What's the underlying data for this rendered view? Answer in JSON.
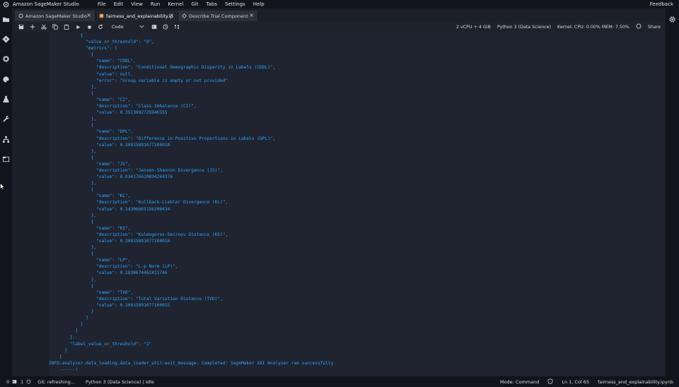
{
  "app": {
    "title": "Amazon SageMaker Studio",
    "feedback": "Feedback"
  },
  "menu": [
    "File",
    "Edit",
    "View",
    "Run",
    "Kernel",
    "Git",
    "Tabs",
    "Settings",
    "Help"
  ],
  "tabs": [
    {
      "label": "Amazon SageMaker Studio",
      "icon": "sagemaker-icon",
      "active": false
    },
    {
      "label": "fairness_and_explainability.ip",
      "icon": "notebook-icon",
      "active": true
    },
    {
      "label": "Describe Trial Component",
      "icon": "experiment-icon",
      "active": false
    }
  ],
  "toolbar": {
    "cell_type": "Code",
    "instance": "2 vCPU + 4 GiB",
    "kernel_name": "Python 3 (Data Science)",
    "kernel_usage": "Kernel: CPU: 0.00% MEM: 7.50%",
    "share": "Share"
  },
  "output": {
    "lines": [
      "            {",
      "              \"value_or_threshold\": \"0\",",
      "              \"metrics\": [",
      "                {",
      "                  \"name\": \"CDDL\",",
      "                  \"description\": \"Conditional Demographic Disparity in Labels (CDDL)\",",
      "                  \"value\": null,",
      "                  \"error\": \"Group variable is empty or not provided\"",
      "                },",
      "                {",
      "                  \"name\": \"CI\",",
      "                  \"description\": \"Class Imbalance (CI)\",",
      "                  \"value\": 0.3513692725946555",
      "                },",
      "                {",
      "                  \"name\": \"DPL\",",
      "                  \"description\": \"Difference in Positive Proportions in Labels (DPL)\",",
      "                  \"value\": 0.20015891077100018",
      "                },",
      "                {",
      "                  \"name\": \"JS\",",
      "                  \"description\": \"Jensen-Shannon Divergence (JS)\",",
      "                  \"value\": 0.034176620894264376",
      "                },",
      "                {",
      "                  \"name\": \"KL\",",
      "                  \"description\": \"Kullback-Liebler Divergence (KL)\",",
      "                  \"value\": 0.14306865156306434",
      "                },",
      "                {",
      "                  \"name\": \"KS\",",
      "                  \"description\": \"Kolmogorov-Smirnov Distance (KS)\",",
      "                  \"value\": 0.20015891077100018",
      "                },",
      "                {",
      "                  \"name\": \"LP\",",
      "                  \"description\": \"L-p Norm (LP)\",",
      "                  \"value\": 0.2830674462421746",
      "                },",
      "                {",
      "                  \"name\": \"TVD\",",
      "                  \"description\": \"Total Variation Distance (TVD)\",",
      "                  \"value\": 0.20015891077100015",
      "                }",
      "              ]",
      "            }",
      "          ]",
      "        },",
      "        \"label_value_or_threshold\": \"1\"",
      "      }",
      "    }",
      "INFO:analyzer.data_loading.data_loader_util:exit_message: Completed: SageMaker XAI Analyzer ran successfully",
      "    ------!"
    ]
  },
  "status": {
    "zero": "0",
    "one": "1",
    "git": "Git: refreshing...",
    "kernel": "Python 3 (Data Science) | Idle",
    "mode": "Mode: Command",
    "position": "Ln 1, Col 65",
    "file": "fairness_and_explainability.ipynb"
  },
  "colors": {
    "output_text": "#2ea4ff",
    "background": "#1b1f27",
    "chrome": "#11141a"
  }
}
